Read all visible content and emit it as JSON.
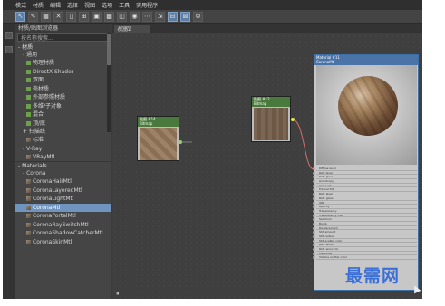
{
  "menu": [
    "模式",
    "材质",
    "编辑",
    "选择",
    "视图",
    "选项",
    "工具",
    "实用程序"
  ],
  "browser": {
    "title": "材质/贴图浏览器",
    "search_placeholder": "按名称搜索...",
    "categories": [
      {
        "label": "- 材质"
      },
      {
        "label": "- 通用"
      }
    ],
    "general_items": [
      "物理材质",
      "DirectX Shader",
      "双面",
      "壳材质",
      "外部参照材质",
      "多维/子对象",
      "混合",
      "顶/底"
    ],
    "scanline_label": "+ 扫描线",
    "scanline_items": [
      "标准"
    ],
    "vray_label": "- V-Ray",
    "vray_items": [
      "VRayMtl"
    ],
    "materials_label": "- Materials",
    "corona_label": "- Corona",
    "corona_items": [
      "CoronaHairMtl",
      "CoronaLayeredMtl",
      "CoronaLightMtl",
      "CoronaMtl",
      "CoronaPortalMtl",
      "CoronaRaySwitchMtl",
      "CoronaShadowCatcherMtl",
      "CoronaSkinMtl"
    ],
    "selected_item": "CoronaMtl"
  },
  "view_tab": "视图1",
  "nodes": {
    "bitmap1": {
      "title": "贴图 #14",
      "subtitle": "Bitmap"
    },
    "bitmap2": {
      "title": "贴图 #12",
      "subtitle": "Bitmap"
    },
    "material": {
      "title": "Material #11",
      "subtitle": "CoronaMtl"
    }
  },
  "material_slots": [
    "Diffuse level",
    "Refl. level",
    "Refl. gloss",
    "Anisotropy",
    "Aniso rot.",
    "Fresnel IOR",
    "Refr. level",
    "Refr. gloss",
    "IOR",
    "Opacity",
    "Translucency",
    "Translucency frac.",
    "Self-illum",
    "Bump",
    "Displacement",
    "SSS amount",
    "SSS radius",
    "SSS scatter color",
    "Refl. aniso",
    "Refl. aniso rot.",
    "Clearcoat",
    "Volume scatter color"
  ],
  "watermark": "最需网",
  "colors": {
    "accent": "#6f94bf",
    "node_header_green": "#49793c",
    "node_header_blue": "#4a74a8",
    "wire": "#d66a6a"
  }
}
